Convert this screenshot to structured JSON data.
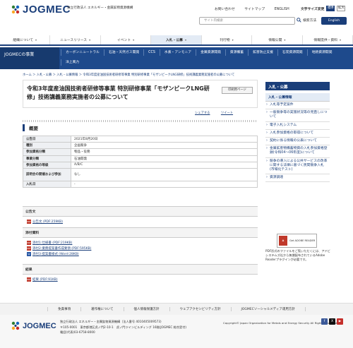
{
  "header": {
    "logo_text": "JOGMEC",
    "org_name": "独立行政法人 エネルギー・金属鉱物資源機構",
    "top_links": [
      "お問い合わせ",
      "サイトマップ",
      "ENGLISH"
    ],
    "font_size_label": "文字サイズ変更",
    "font_size_options": [
      "標準",
      "拡大"
    ],
    "search_placeholder": "サイト内検索",
    "search_button": "検索方法",
    "english_button": "English"
  },
  "global_nav": [
    {
      "label": "組織について",
      "active": false
    },
    {
      "label": "ニュースリリース",
      "active": false
    },
    {
      "label": "イベント",
      "active": false
    },
    {
      "label": "入札・公募",
      "active": true
    },
    {
      "label": "刊行物",
      "active": false
    },
    {
      "label": "情報公開",
      "active": false
    },
    {
      "label": "情報提供・資料",
      "active": false
    }
  ],
  "sub_nav": {
    "title": "JOGMECの事業",
    "items": [
      "カーボンニュートラル",
      "石油・天然ガス開発",
      "CCS",
      "水素・アンモニア",
      "金属資源開発",
      "資源備蓄",
      "鉱害防止支援",
      "石炭資源開発",
      "地熱資源開発",
      "洋上風力"
    ]
  },
  "breadcrumb": "ホーム ＞ 入札・公募 ＞ 入札・公募情報 ＞ 令和3年度産油国技術者研修等事業 特別研修事業「モザンビークLNG研修」技術講義業務実施者の公募について",
  "page": {
    "title": "令和3年度産油国技術者研修等事業 特別研修事業「モザンビークLNG研修」技術講義業務実施者の公募について",
    "print_button": "印刷用ページ",
    "share_links": [
      "シェアする",
      "ツイート"
    ]
  },
  "overview": {
    "heading": "概要",
    "rows": [
      {
        "key": "公告日",
        "value": "2021年8月20日"
      },
      {
        "key": "種別",
        "value": "企画競争"
      },
      {
        "key": "参加資格分類",
        "value": "物品・役務"
      },
      {
        "key": "事業分類",
        "value": "石油開発"
      },
      {
        "key": "参加資格の等級",
        "value": "A/B/C"
      },
      {
        "key": "説明会の開催および参加",
        "value": "なし"
      },
      {
        "key": "入札日",
        "value": "-"
      }
    ]
  },
  "attachments": [
    {
      "heading": "公告文",
      "items": [
        {
          "label": "公告文 (PDF:259KB)",
          "type": "pdf"
        }
      ]
    },
    {
      "heading": "添付資料",
      "items": [
        {
          "label": "添付1:仕様書 (PDF:219KB)",
          "type": "pdf"
        },
        {
          "label": "添付2:業務提案書作成要領 (PDF:595KB)",
          "type": "pdf"
        },
        {
          "label": "添付3:提案書様式 (Word:28KB)",
          "type": "word"
        }
      ]
    },
    {
      "heading": "結果",
      "items": [
        {
          "label": "結果 (PDF:91KB)",
          "type": "pdf"
        }
      ]
    }
  ],
  "sidebar": {
    "heading": "入札・公募",
    "subheading": "入札・公募情報",
    "items": [
      "入札等予定案件",
      "一般競争等の実施状況等の見直しについて",
      "電子入札システム",
      "入札参加資格の取得について",
      "契約に係る情報の公表について",
      "金属鉱産物備蓄物資の入札参加資格登録(令和04〜06年度)について",
      "競争の導入による公共サービスの改革に関する法律に基づく民間競争入札(市場化テスト)",
      "資源調達"
    ]
  },
  "adobe": {
    "label": "Get ADOBE READER",
    "note": "PDF形式のファイルをご覧いただくには、アドビシステムズ社から無償配布されているAdobe Readerプラグインが必要です。"
  },
  "footer_links": [
    "免責事項",
    "著作権について",
    "個人情報保護方針",
    "ウェブアクセシビリティ方針",
    "JOGMECソーシャルメディア運用方針"
  ],
  "footer": {
    "logo_text": "JOGMEC",
    "org": "独立行政法人 エネルギー・金属鉱物資源機構（法人番号 4010405009573）",
    "address": "〒105-0001　東京都港区虎ノ門2-10-1　虎ノ門ツインビルディング 16階(JOGMEC 総合受付)",
    "phone": "電話(代表)03-6758-8000",
    "copyright": "Copyright© Japan Organization for Metals and Energy Security All Rights Reserved."
  },
  "colors": {
    "primary": "#1a3e7a",
    "subnav": "#1e4a8c",
    "accent": "#c0392b"
  }
}
